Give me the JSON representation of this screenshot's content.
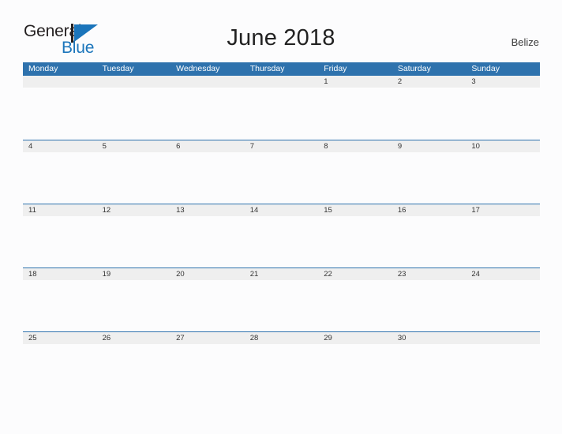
{
  "brand": {
    "name_part1": "General",
    "name_part2": "Blue",
    "logo_icon": "blue-flag-triangle-icon"
  },
  "header": {
    "title": "June 2018",
    "country": "Belize"
  },
  "colors": {
    "header_blue": "#2e72ad",
    "date_strip_grey": "#efefef",
    "page_background": "#fcfcfd",
    "logo_blue": "#1b75bb",
    "text_dark": "#231f20"
  },
  "calendar": {
    "weekdays": [
      "Monday",
      "Tuesday",
      "Wednesday",
      "Thursday",
      "Friday",
      "Saturday",
      "Sunday"
    ],
    "weeks": [
      {
        "days": [
          "",
          "",
          "",
          "",
          "1",
          "2",
          "3"
        ]
      },
      {
        "days": [
          "4",
          "5",
          "6",
          "7",
          "8",
          "9",
          "10"
        ]
      },
      {
        "days": [
          "11",
          "12",
          "13",
          "14",
          "15",
          "16",
          "17"
        ]
      },
      {
        "days": [
          "18",
          "19",
          "20",
          "21",
          "22",
          "23",
          "24"
        ]
      },
      {
        "days": [
          "25",
          "26",
          "27",
          "28",
          "29",
          "30",
          ""
        ]
      }
    ]
  }
}
